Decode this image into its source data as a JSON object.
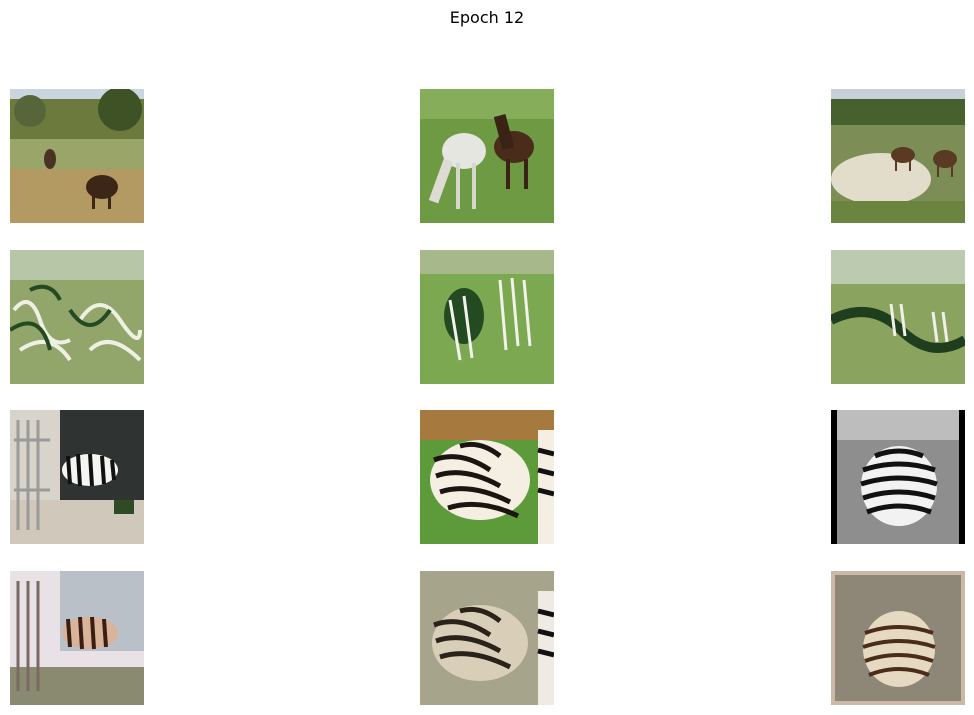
{
  "figure": {
    "title": "Epoch 12"
  }
}
